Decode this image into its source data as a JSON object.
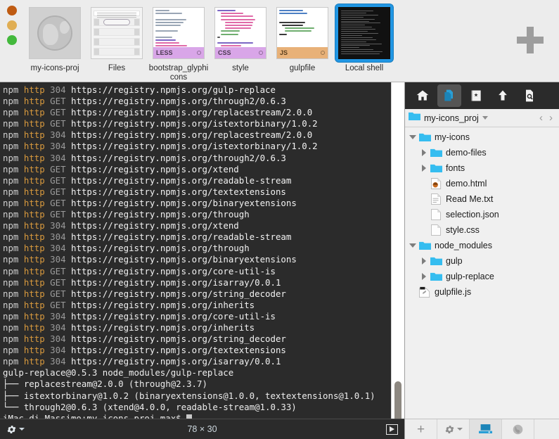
{
  "window": {
    "traffic_lights": [
      "close",
      "minimize",
      "zoom"
    ]
  },
  "tabs": [
    {
      "label": "my-icons-proj",
      "kind": "globe",
      "active": false
    },
    {
      "label": "Files",
      "kind": "files",
      "active": false
    },
    {
      "label": "bootstrap_glyphicons",
      "kind": "code",
      "lang": "LESS",
      "active": false
    },
    {
      "label": "style",
      "kind": "code",
      "lang": "CSS",
      "active": false
    },
    {
      "label": "gulpfile",
      "kind": "code",
      "lang": "JS",
      "active": false
    },
    {
      "label": "Local shell",
      "kind": "terminal",
      "active": true
    }
  ],
  "new_tab_button": {
    "name": "plus",
    "label": "+"
  },
  "terminal": {
    "lines": [
      {
        "type": "npm",
        "tag": "npm",
        "method": "http",
        "code": "304",
        "url": "https://registry.npmjs.org/gulp-replace"
      },
      {
        "type": "npm",
        "tag": "npm",
        "method": "http",
        "code": "GET",
        "url": "https://registry.npmjs.org/through2/0.6.3"
      },
      {
        "type": "npm",
        "tag": "npm",
        "method": "http",
        "code": "GET",
        "url": "https://registry.npmjs.org/replacestream/2.0.0"
      },
      {
        "type": "npm",
        "tag": "npm",
        "method": "http",
        "code": "GET",
        "url": "https://registry.npmjs.org/istextorbinary/1.0.2"
      },
      {
        "type": "npm",
        "tag": "npm",
        "method": "http",
        "code": "304",
        "url": "https://registry.npmjs.org/replacestream/2.0.0"
      },
      {
        "type": "npm",
        "tag": "npm",
        "method": "http",
        "code": "304",
        "url": "https://registry.npmjs.org/istextorbinary/1.0.2"
      },
      {
        "type": "npm",
        "tag": "npm",
        "method": "http",
        "code": "304",
        "url": "https://registry.npmjs.org/through2/0.6.3"
      },
      {
        "type": "npm",
        "tag": "npm",
        "method": "http",
        "code": "GET",
        "url": "https://registry.npmjs.org/xtend"
      },
      {
        "type": "npm",
        "tag": "npm",
        "method": "http",
        "code": "GET",
        "url": "https://registry.npmjs.org/readable-stream"
      },
      {
        "type": "npm",
        "tag": "npm",
        "method": "http",
        "code": "GET",
        "url": "https://registry.npmjs.org/textextensions"
      },
      {
        "type": "npm",
        "tag": "npm",
        "method": "http",
        "code": "GET",
        "url": "https://registry.npmjs.org/binaryextensions"
      },
      {
        "type": "npm",
        "tag": "npm",
        "method": "http",
        "code": "GET",
        "url": "https://registry.npmjs.org/through"
      },
      {
        "type": "npm",
        "tag": "npm",
        "method": "http",
        "code": "304",
        "url": "https://registry.npmjs.org/xtend"
      },
      {
        "type": "npm",
        "tag": "npm",
        "method": "http",
        "code": "304",
        "url": "https://registry.npmjs.org/readable-stream"
      },
      {
        "type": "npm",
        "tag": "npm",
        "method": "http",
        "code": "304",
        "url": "https://registry.npmjs.org/through"
      },
      {
        "type": "npm",
        "tag": "npm",
        "method": "http",
        "code": "304",
        "url": "https://registry.npmjs.org/binaryextensions"
      },
      {
        "type": "npm",
        "tag": "npm",
        "method": "http",
        "code": "GET",
        "url": "https://registry.npmjs.org/core-util-is"
      },
      {
        "type": "npm",
        "tag": "npm",
        "method": "http",
        "code": "GET",
        "url": "https://registry.npmjs.org/isarray/0.0.1"
      },
      {
        "type": "npm",
        "tag": "npm",
        "method": "http",
        "code": "GET",
        "url": "https://registry.npmjs.org/string_decoder"
      },
      {
        "type": "npm",
        "tag": "npm",
        "method": "http",
        "code": "GET",
        "url": "https://registry.npmjs.org/inherits"
      },
      {
        "type": "npm",
        "tag": "npm",
        "method": "http",
        "code": "304",
        "url": "https://registry.npmjs.org/core-util-is"
      },
      {
        "type": "npm",
        "tag": "npm",
        "method": "http",
        "code": "304",
        "url": "https://registry.npmjs.org/inherits"
      },
      {
        "type": "npm",
        "tag": "npm",
        "method": "http",
        "code": "304",
        "url": "https://registry.npmjs.org/string_decoder"
      },
      {
        "type": "npm",
        "tag": "npm",
        "method": "http",
        "code": "304",
        "url": "https://registry.npmjs.org/textextensions"
      },
      {
        "type": "npm",
        "tag": "npm",
        "method": "http",
        "code": "304",
        "url": "https://registry.npmjs.org/isarray/0.0.1"
      },
      {
        "type": "plain",
        "text": "gulp-replace@0.5.3 node_modules/gulp-replace"
      },
      {
        "type": "plain",
        "text": "├── replacestream@2.0.0 (through@2.3.7)"
      },
      {
        "type": "plain",
        "text": "├── istextorbinary@1.0.2 (binaryextensions@1.0.0, textextensions@1.0.1)"
      },
      {
        "type": "plain",
        "text": "└── through2@0.6.3 (xtend@4.0.0, readable-stream@1.0.33)"
      }
    ],
    "prompt": "iMac-di-Massimo:my-icons_proj max$ "
  },
  "statusbar": {
    "gear_label": "settings",
    "dimensions": "78 × 30",
    "play_label": "run"
  },
  "sidebar": {
    "toolbar": [
      {
        "name": "home-icon",
        "label": "Home",
        "active": false
      },
      {
        "name": "files-icon",
        "label": "Files",
        "active": true
      },
      {
        "name": "snippets-icon",
        "label": "Snippets",
        "active": false
      },
      {
        "name": "upload-icon",
        "label": "Upload",
        "active": false
      },
      {
        "name": "search-file-icon",
        "label": "Find",
        "active": false
      }
    ],
    "breadcrumb": {
      "name": "my-icons_proj"
    },
    "nav": {
      "back": "‹",
      "forward": "›"
    },
    "tree": [
      {
        "label": "my-icons",
        "type": "folder",
        "indent": 0,
        "state": "open"
      },
      {
        "label": "demo-files",
        "type": "folder",
        "indent": 1,
        "state": "closed"
      },
      {
        "label": "fonts",
        "type": "folder",
        "indent": 1,
        "state": "closed"
      },
      {
        "label": "demo.html",
        "type": "html",
        "indent": 1,
        "state": "none"
      },
      {
        "label": "Read Me.txt",
        "type": "text",
        "indent": 1,
        "state": "none"
      },
      {
        "label": "selection.json",
        "type": "file",
        "indent": 1,
        "state": "none"
      },
      {
        "label": "style.css",
        "type": "file",
        "indent": 1,
        "state": "none"
      },
      {
        "label": "node_modules",
        "type": "folder",
        "indent": 0,
        "state": "open"
      },
      {
        "label": "gulp",
        "type": "folder",
        "indent": 1,
        "state": "closed"
      },
      {
        "label": "gulp-replace",
        "type": "folder",
        "indent": 1,
        "state": "closed"
      },
      {
        "label": "gulpfile.js",
        "type": "script",
        "indent": 0,
        "state": "none"
      }
    ],
    "bottom_toolbar": [
      {
        "name": "add-icon",
        "label": "+",
        "active": false
      },
      {
        "name": "gear-icon",
        "label": "settings",
        "active": false
      },
      {
        "name": "local-disk-icon",
        "label": "Local",
        "active": true
      },
      {
        "name": "remote-globe-icon",
        "label": "Remote",
        "active": false
      }
    ]
  },
  "colors": {
    "terminal_bg": "#2b2b2b",
    "accent_blue": "#2196e3",
    "folder_blue": "#29b6ef",
    "http_orange": "#d99a3e",
    "chrome_gray": "#ececec"
  }
}
